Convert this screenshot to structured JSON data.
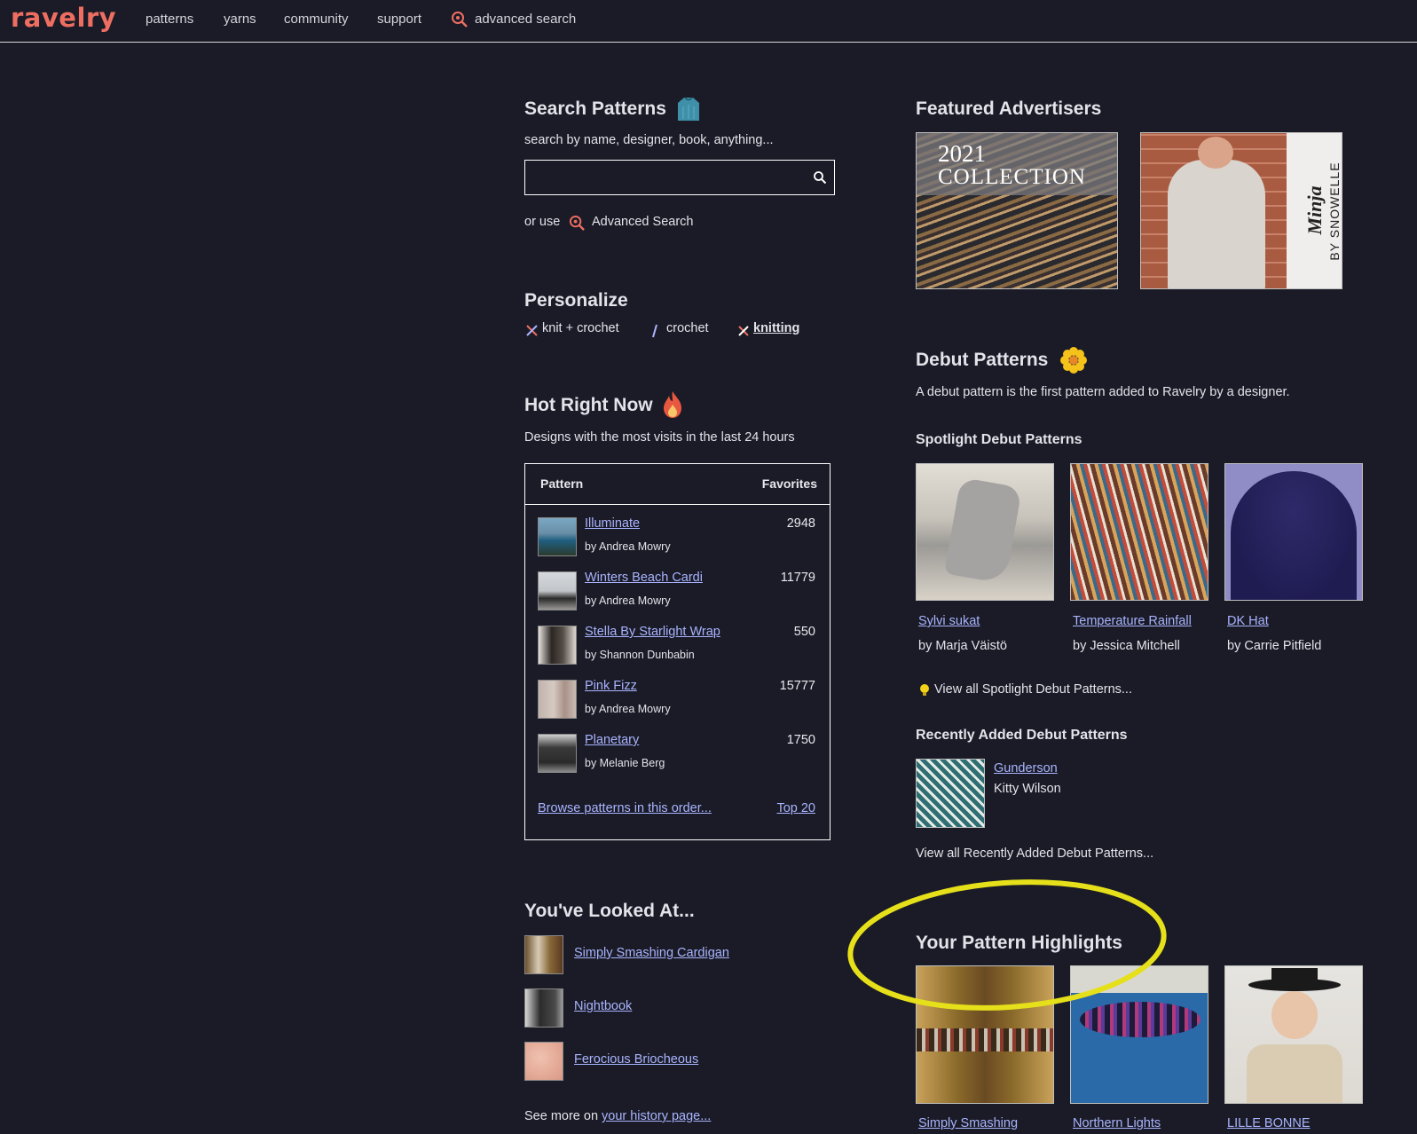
{
  "nav": {
    "logo": "ravelry",
    "items": [
      "patterns",
      "yarns",
      "community",
      "support"
    ],
    "advanced_search": "advanced search"
  },
  "search": {
    "title": "Search Patterns",
    "hint": "search by name, designer, book, anything...",
    "placeholder": "",
    "or_use": "or use",
    "advanced_link": "Advanced Search"
  },
  "personalize": {
    "title": "Personalize",
    "options": [
      "knit + crochet",
      "crochet",
      "knitting"
    ],
    "selected": "knitting"
  },
  "hot": {
    "title": "Hot Right Now",
    "subtitle": "Designs with the most visits in the last 24 hours",
    "col_pattern": "Pattern",
    "col_favorites": "Favorites",
    "rows": [
      {
        "name": "Illuminate",
        "by": "by Andrea Mowry",
        "favorites": "2948"
      },
      {
        "name": "Winters Beach Cardi",
        "by": "by Andrea Mowry",
        "favorites": "11779"
      },
      {
        "name": "Stella By Starlight Wrap",
        "by": "by Shannon Dunbabin",
        "favorites": "550"
      },
      {
        "name": "Pink Fizz",
        "by": "by Andrea Mowry",
        "favorites": "15777"
      },
      {
        "name": "Planetary",
        "by": "by Melanie Berg",
        "favorites": "1750"
      }
    ],
    "browse": "Browse patterns in this order...",
    "top20": "Top 20"
  },
  "looked": {
    "title": "You've Looked At...",
    "items": [
      "Simply Smashing Cardigan",
      "Nightbook",
      "Ferocious Briocheous"
    ],
    "see_more": "See more on",
    "history_link": "your history page..."
  },
  "advertisers": {
    "title": "Featured Advertisers",
    "ad1_line1": "2021",
    "ad1_line2": "COLLECTION",
    "ad2_script": "Minja",
    "ad2_by": "BY SNOWELLE"
  },
  "debut": {
    "title": "Debut Patterns",
    "desc": "A debut pattern is the first pattern added to Ravelry by a designer.",
    "spotlight_title": "Spotlight Debut Patterns",
    "spotlight": [
      {
        "name": "Sylvi sukat",
        "by": "by Marja Väistö"
      },
      {
        "name": "Temperature Rainfall",
        "by": "by Jessica Mitchell"
      },
      {
        "name": "DK Hat",
        "by": "by Carrie Pitfield"
      }
    ],
    "view_spotlight": "View all Spotlight Debut Patterns...",
    "recent_title": "Recently Added Debut Patterns",
    "recent": {
      "name": "Gunderson",
      "by": "Kitty Wilson"
    },
    "view_recent": "View all Recently Added Debut Patterns..."
  },
  "highlights": {
    "title": "Your Pattern Highlights",
    "items": [
      "Simply Smashing",
      "Northern Lights",
      "LILLE BONNE"
    ]
  },
  "colors": {
    "background": "#1a1b26",
    "link": "#a9b4ff",
    "logo": "#ee6e62",
    "annotation": "#e6e01a"
  }
}
